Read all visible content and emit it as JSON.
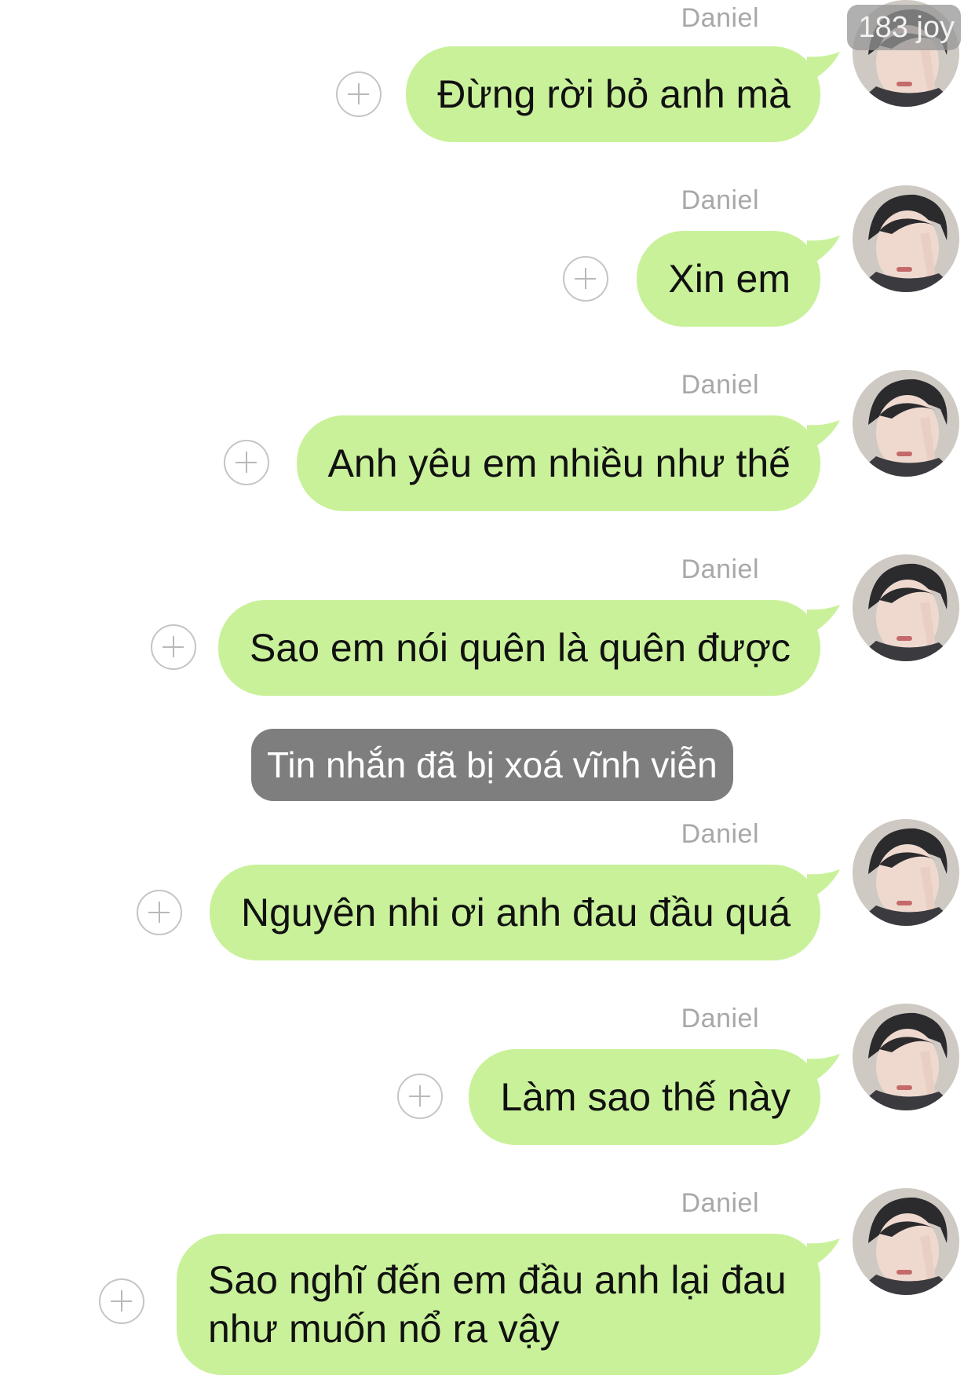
{
  "watermark": "183 joy",
  "messages": [
    {
      "sender": "Daniel",
      "text": "Đừng rời bỏ anh mà"
    },
    {
      "sender": "Daniel",
      "text": "Xin em"
    },
    {
      "sender": "Daniel",
      "text": "Anh yêu em nhiều như thế"
    },
    {
      "sender": "Daniel",
      "text": "Sao em nói quên là quên được"
    },
    {
      "sender": "Daniel",
      "text": "Nguyên nhi ơi anh đau đầu quá"
    },
    {
      "sender": "Daniel",
      "text": "Làm sao thế này"
    },
    {
      "sender": "Daniel",
      "text": "Sao nghĩ đến em đầu anh lại đau như muốn nổ ra vậy"
    }
  ],
  "system_notice": "Tin nhắn đã bị xoá vĩnh viễn",
  "icons": {
    "add": "plus-circle-icon",
    "avatar": "avatar"
  },
  "colors": {
    "bubble": "#c9f19a",
    "notice_bg": "#7e7e7e",
    "sender": "#a8a8a8"
  }
}
